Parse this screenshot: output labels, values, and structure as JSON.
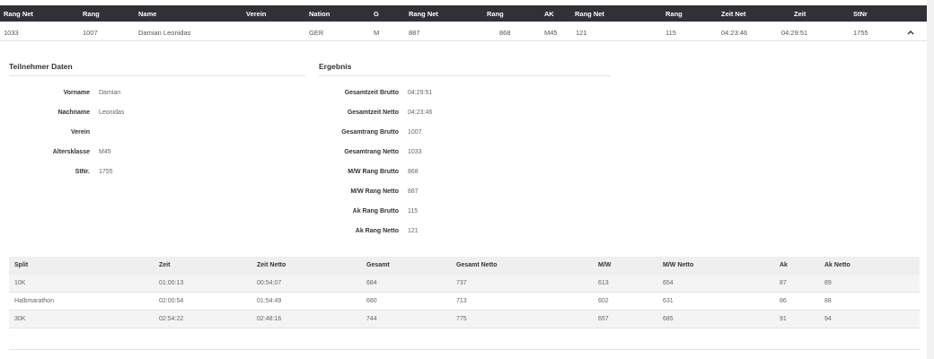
{
  "header": {
    "columns": [
      "Rang Net",
      "Rang",
      "Name",
      "Verein",
      "Nation",
      "G",
      "Rang Net",
      "Rang",
      "AK",
      "Rang Net",
      "Rang",
      "Zeit Net",
      "Zeit",
      "StNr"
    ]
  },
  "result_row": {
    "cells": [
      "1033",
      "1007",
      "Damian Leonidas",
      "",
      "GER",
      "M",
      "887",
      "868",
      "M45",
      "121",
      "115",
      "04:23:46",
      "04:29:51",
      "1755"
    ]
  },
  "teilnehmer": {
    "title": "Teilnehmer Daten",
    "fields": [
      {
        "label": "Vorname",
        "value": "Damian"
      },
      {
        "label": "Nachname",
        "value": "Leonidas"
      },
      {
        "label": "Verein",
        "value": ""
      },
      {
        "label": "Altersklasse",
        "value": "M45"
      },
      {
        "label": "StNr.",
        "value": "1755"
      }
    ]
  },
  "ergebnis": {
    "title": "Ergebnis",
    "fields": [
      {
        "label": "Gesamtzeit Brutto",
        "value": "04:29:51"
      },
      {
        "label": "Gesamtzeit Netto",
        "value": "04:23:46"
      },
      {
        "label": "Gesamtrang Brutto",
        "value": "1007"
      },
      {
        "label": "Gesamtrang Netto",
        "value": "1033"
      },
      {
        "label": "M/W Rang Brutto",
        "value": "868"
      },
      {
        "label": "M/W Rang Netto",
        "value": "887"
      },
      {
        "label": "Ak Rang Brutto",
        "value": "115"
      },
      {
        "label": "Ak Rang Netto",
        "value": "121"
      }
    ]
  },
  "splits": {
    "headers": [
      "Split",
      "Zeit",
      "Zeit Netto",
      "Gesamt",
      "Gesamt Netto",
      "M/W",
      "M/W Netto",
      "Ak",
      "Ak Netto"
    ],
    "rows": [
      [
        "10K",
        "01:00:13",
        "00:54:07",
        "684",
        "737",
        "613",
        "654",
        "87",
        "89"
      ],
      [
        "Halbmarathon",
        "02:00:54",
        "01:54:49",
        "680",
        "713",
        "602",
        "631",
        "86",
        "88"
      ],
      [
        "30K",
        "02:54:22",
        "02:48:16",
        "744",
        "775",
        "657",
        "685",
        "91",
        "94"
      ]
    ]
  },
  "icons": {
    "collapse": "chevron-up-icon"
  },
  "colors": {
    "header_bg": "#2f3136",
    "header_text": "#ffffff",
    "table_head_bg": "#efefef",
    "alt_row_bg": "#f4f4f4"
  }
}
